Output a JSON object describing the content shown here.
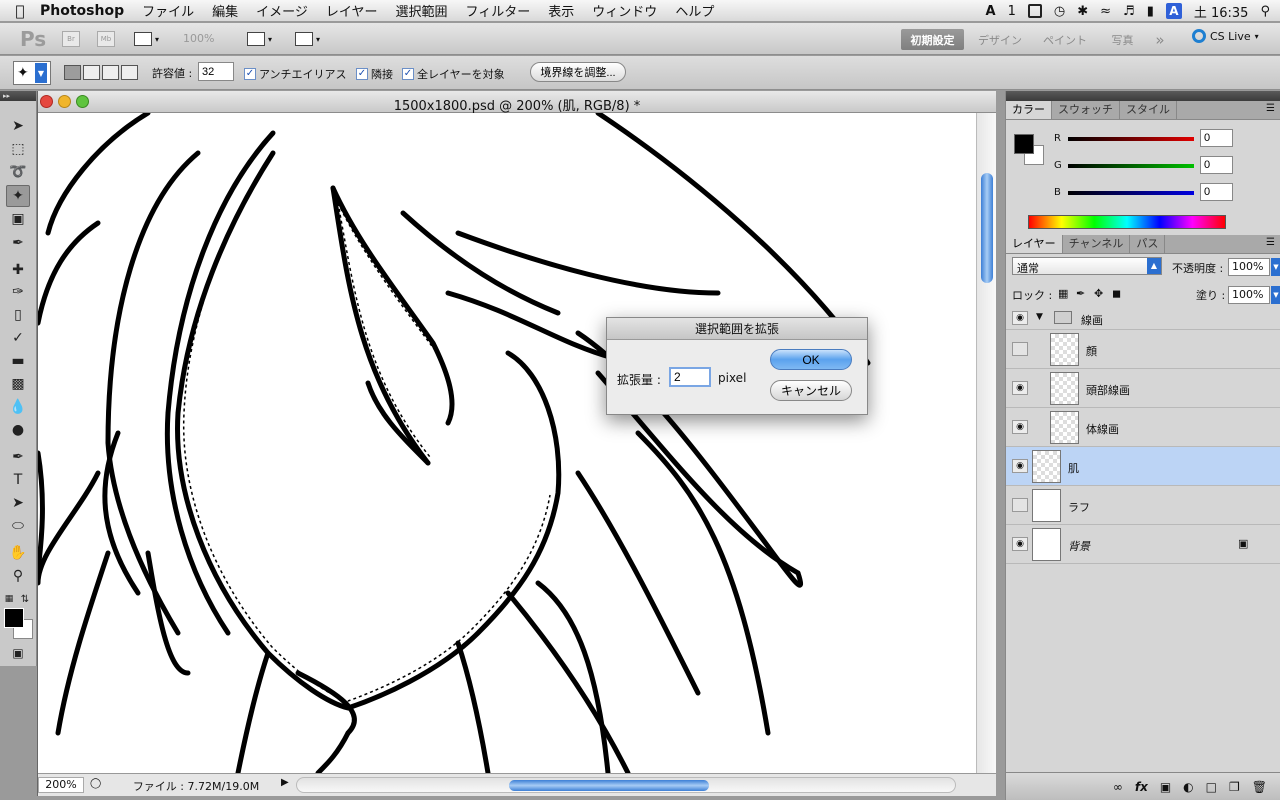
{
  "menubar": {
    "app_name": "Photoshop",
    "menus": [
      "ファイル",
      "編集",
      "イメージ",
      "レイヤー",
      "選択範囲",
      "フィルター",
      "表示",
      "ウィンドウ",
      "ヘルプ"
    ],
    "status_num": "1",
    "clock": "土 16:35"
  },
  "appbar": {
    "logo": "Ps",
    "zoom": "100%",
    "workspaces": [
      "初期設定",
      "デザイン",
      "ペイント",
      "写真"
    ],
    "more": "»",
    "cslive": "CS Live"
  },
  "options": {
    "tolerance_label": "許容値 :",
    "tolerance_value": "32",
    "antialias_label": "アンチエイリアス",
    "contiguous_label": "隣接",
    "all_layers_label": "全レイヤーを対象",
    "refine_edge_label": "境界線を調整..."
  },
  "document": {
    "title": "1500x1800.psd @ 200% (肌, RGB/8) *",
    "zoom": "200%",
    "file_info": "ファイル : 7.72M/19.0M"
  },
  "dialog": {
    "title": "選択範囲を拡張",
    "expand_label": "拡張量 :",
    "expand_value": "2",
    "unit": "pixel",
    "ok": "OK",
    "cancel": "キャンセル"
  },
  "color_panel": {
    "tabs": [
      "カラー",
      "スウォッチ",
      "スタイル"
    ],
    "sliders": [
      {
        "label": "R",
        "value": "0",
        "color": "#e00000"
      },
      {
        "label": "G",
        "value": "0",
        "color": "#00c000"
      },
      {
        "label": "B",
        "value": "0",
        "color": "#0000e0"
      }
    ]
  },
  "layers_panel": {
    "tabs": [
      "レイヤー",
      "チャンネル",
      "パス"
    ],
    "blend_mode": "通常",
    "opacity_label": "不透明度 :",
    "opacity_value": "100%",
    "lock_label": "ロック :",
    "fill_label": "塗り :",
    "fill_value": "100%",
    "layers": [
      {
        "name": "線画",
        "type": "group",
        "visible": true
      },
      {
        "name": "顔",
        "visible": false
      },
      {
        "name": "頭部線画",
        "visible": true
      },
      {
        "name": "体線画",
        "visible": true
      },
      {
        "name": "肌",
        "visible": true,
        "selected": true
      },
      {
        "name": "ラフ",
        "visible": false
      },
      {
        "name": "背景",
        "visible": true,
        "locked": true
      }
    ]
  },
  "colors": {
    "accent": "#5ba2ee",
    "selection": "#bcd4f5"
  }
}
